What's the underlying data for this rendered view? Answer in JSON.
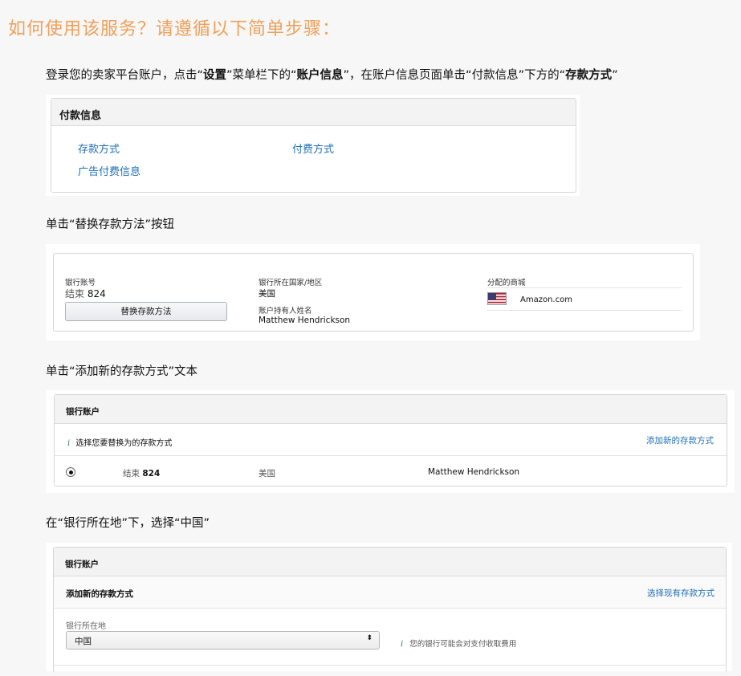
{
  "heading": "如何使用该服务？请遵循以下简单步骤：",
  "steps": {
    "s1": {
      "a": "登录您的卖家平台账户，点击“",
      "b": "设置",
      "c": "”菜单栏下的“",
      "d": "账户信息",
      "e": "”，在账户信息页面单击“付款信息”下方的“",
      "f": "存款方式",
      "g": "”"
    },
    "s2": "单击“替换存款方法”按钮",
    "s3": "单击“添加新的存款方式”文本",
    "s4": "在“银行所在地”下，选择“中国”"
  },
  "payment_info": {
    "title": "付款信息",
    "links": [
      "存款方式",
      "付费方式",
      "广告付费信息"
    ]
  },
  "deposit_panel": {
    "bank_account_label": "银行账号",
    "ending_label": "结束",
    "ending_number": "824",
    "replace_button": "替换存款方法",
    "country_label": "银行所在国家/地区",
    "country_value": "美国",
    "holder_label": "账户持有人姓名",
    "holder_value": "Matthew Hendrickson",
    "marketplace_label": "分配的商城",
    "marketplace_value": "Amazon.com"
  },
  "bank_select_panel": {
    "title": "银行账户",
    "info_icon": "i",
    "info_text": "选择您要替换为的存款方式",
    "add_link": "添加新的存款方式",
    "row": {
      "ending_label": "结束",
      "ending_number": "824",
      "country": "美国",
      "holder": "Matthew Hendrickson"
    }
  },
  "add_method_panel": {
    "title": "银行账户",
    "subtitle": "添加新的存款方式",
    "select_existing_link": "选择现有存款方式",
    "location_label": "银行所在地",
    "location_value": "中国",
    "caret": "⬍",
    "info_icon": "i",
    "fee_note": "您的银行可能会对支付收取费用"
  },
  "colors": {
    "heading": "#f0a05a",
    "link": "#1f6fb5"
  }
}
